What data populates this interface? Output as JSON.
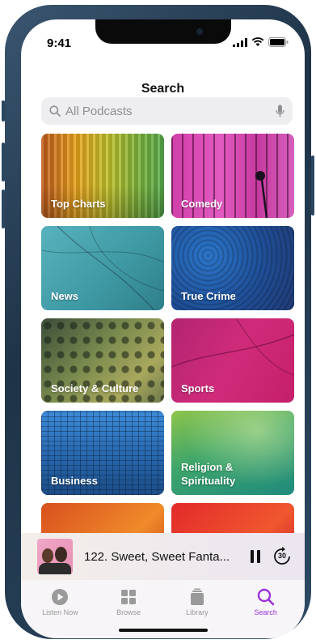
{
  "status": {
    "time": "9:41"
  },
  "header": {
    "title": "Search"
  },
  "search": {
    "placeholder": "All Podcasts",
    "icon": "search-icon",
    "mic_icon": "microphone-icon"
  },
  "categories": [
    {
      "label": "Top Charts"
    },
    {
      "label": "Comedy"
    },
    {
      "label": "News"
    },
    {
      "label": "True Crime"
    },
    {
      "label": "Society & Culture"
    },
    {
      "label": "Sports"
    },
    {
      "label": "Business"
    },
    {
      "label": "Religion & Spirituality"
    }
  ],
  "now_playing": {
    "title": "122. Sweet, Sweet Fanta...",
    "skip_label": "30"
  },
  "tabs": [
    {
      "label": "Listen Now",
      "icon": "play-circle-icon"
    },
    {
      "label": "Browse",
      "icon": "grid-icon"
    },
    {
      "label": "Library",
      "icon": "library-icon"
    },
    {
      "label": "Search",
      "icon": "search-icon"
    }
  ],
  "colors": {
    "accent": "#9b30d9",
    "inactive": "#9a9a9a"
  }
}
